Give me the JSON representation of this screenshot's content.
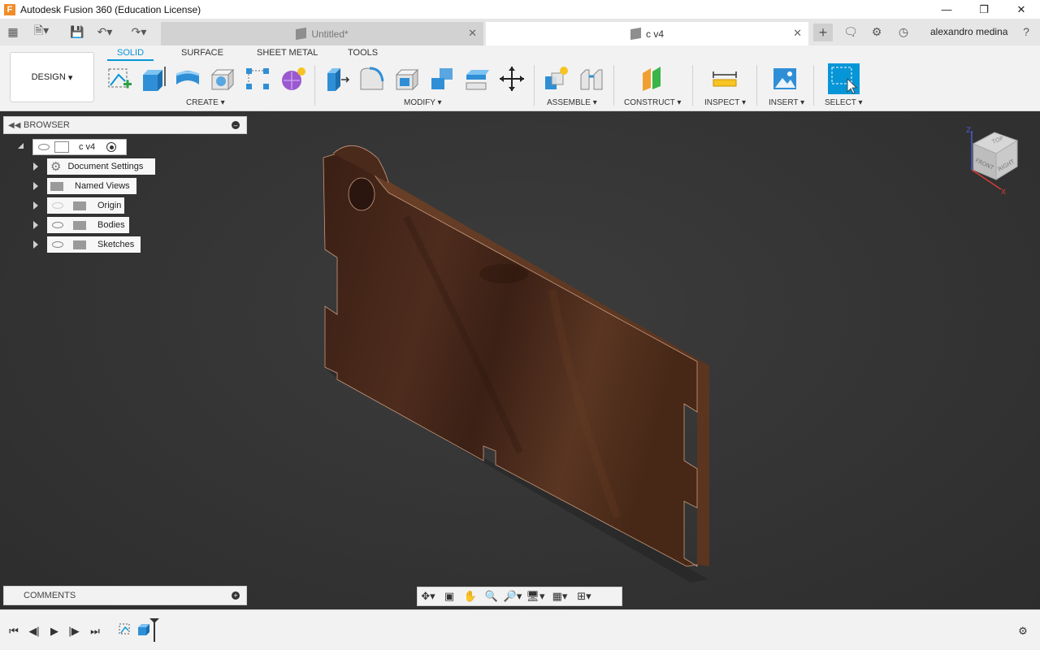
{
  "window": {
    "title": "Autodesk Fusion 360 (Education License)",
    "app_icon": "F"
  },
  "tabs": {
    "inactive_tab": "Untitled*",
    "active_tab": "c v4",
    "user": "alexandro medina"
  },
  "ribbon": {
    "workspace": "DESIGN",
    "tabs": [
      "SOLID",
      "SURFACE",
      "SHEET METAL",
      "TOOLS"
    ],
    "groups": [
      "CREATE",
      "MODIFY",
      "ASSEMBLE",
      "CONSTRUCT",
      "INSPECT",
      "INSERT",
      "SELECT"
    ]
  },
  "browser": {
    "title": "BROWSER",
    "root": "c v4",
    "items": [
      "Document Settings",
      "Named Views",
      "Origin",
      "Bodies",
      "Sketches"
    ]
  },
  "comments": {
    "title": "COMMENTS"
  },
  "viewcube": {
    "top": "TOP",
    "front": "FRONT",
    "right": "RIGHT",
    "axis_x": "X",
    "axis_z": "Z"
  },
  "colors": {
    "accent": "#0696d7",
    "viewport": "#333333",
    "wood": "#4a2a1b"
  }
}
